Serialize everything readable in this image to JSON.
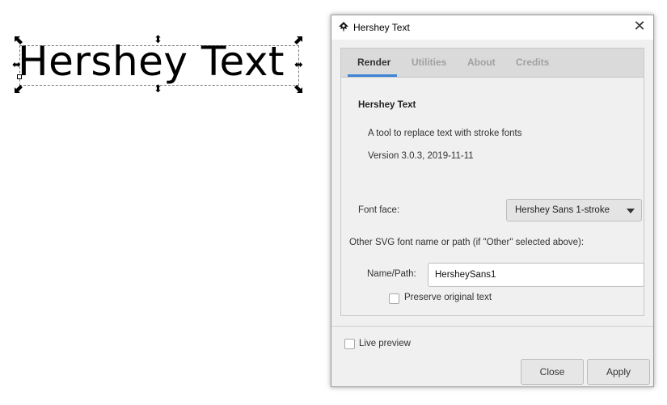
{
  "canvas": {
    "text": "Hershey Text",
    "selection_handles": {
      "arrow_h": "⬌",
      "arrow_v": "⬍"
    }
  },
  "dialog": {
    "title": "Hershey Text",
    "title_icon": "inkscape-logo-icon",
    "close_glyph": "✕",
    "tabs": [
      {
        "label": "Render",
        "active": true
      },
      {
        "label": "Utilities",
        "active": false
      },
      {
        "label": "About",
        "active": false
      },
      {
        "label": "Credits",
        "active": false
      }
    ],
    "render": {
      "section_title": "Hershey Text",
      "description": "A tool to replace text with stroke fonts",
      "version": "Version 3.0.3, 2019-11-11",
      "font_face_label": "Font face:",
      "font_face_value": "Hershey Sans 1-stroke",
      "other_font_label": "Other SVG font name or path (if \"Other\" selected above):",
      "name_path_label": "Name/Path:",
      "name_path_value": "HersheySans1",
      "preserve_label": "Preserve original text",
      "preserve_checked": false
    },
    "live_preview_label": "Live preview",
    "live_preview_checked": false,
    "buttons": {
      "close": "Close",
      "apply": "Apply"
    }
  },
  "colors": {
    "tab_accent": "#3b83d6",
    "dialog_bg": "#f0f0f0",
    "tabbar_bg": "#dadada"
  }
}
